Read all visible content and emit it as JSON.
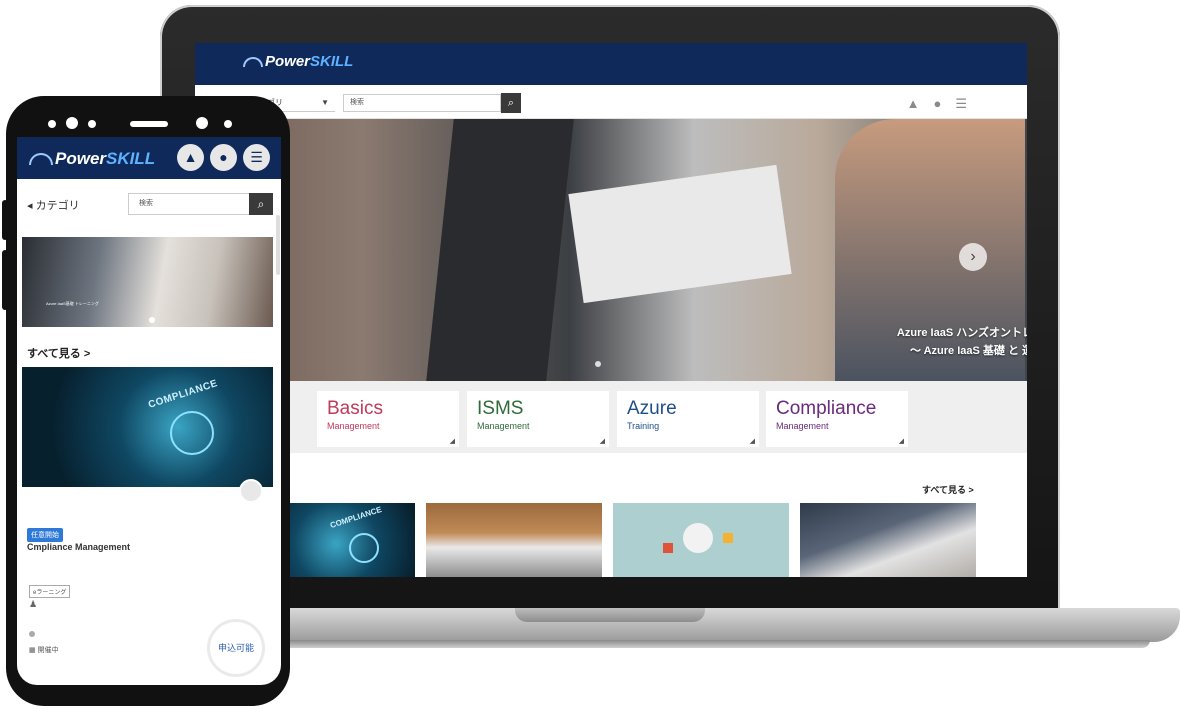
{
  "brand": {
    "power": "Power",
    "skill": "SKILL"
  },
  "laptop": {
    "toolbar": {
      "category": "カテゴリ",
      "search_placeholder": "検索"
    },
    "hero": {
      "caption_line1": "Azure IaaS ハンズオントレ",
      "caption_line2": "～ Azure IaaS 基礎 と 運"
    },
    "categories": [
      {
        "title": "Basics",
        "subtitle": "Management",
        "color": "#c0395a"
      },
      {
        "title": "ISMS",
        "subtitle": "Management",
        "color": "#2f6b3a"
      },
      {
        "title": "Azure",
        "subtitle": "Training",
        "color": "#1f4f8a"
      },
      {
        "title": "Compliance",
        "subtitle": "Management",
        "color": "#6b2a7a"
      }
    ],
    "see_all": "すべて見る >",
    "thumb_compliance": "COMPLIANCE"
  },
  "phone": {
    "category": "◂ カテゴリ",
    "search_placeholder": "検索",
    "banner_text": "Azure IaaS基礎 トレーニング",
    "see_all": "すべて見る >",
    "course": {
      "image_text": "COMPLIANCE",
      "badge": "任意開始",
      "title": "Cmpliance Management",
      "tag": "eラーニング",
      "status": "開催中",
      "apply_label": "申込可能"
    }
  }
}
